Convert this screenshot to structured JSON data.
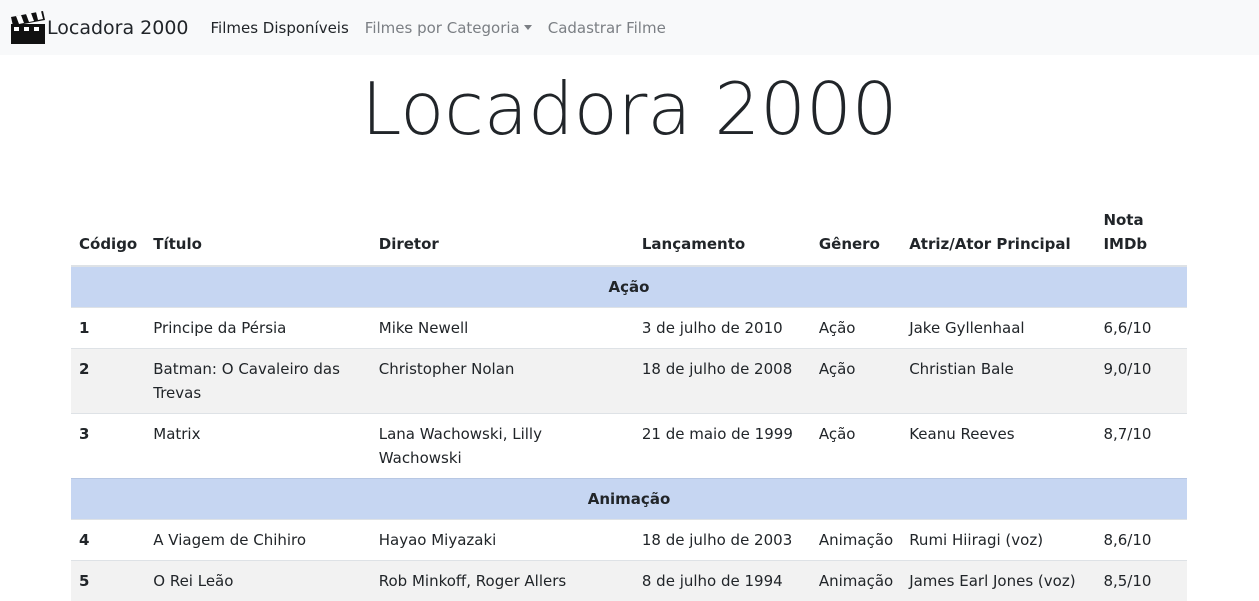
{
  "navbar": {
    "brand": "Locadora 2000",
    "links": [
      {
        "label": "Filmes Disponíveis"
      },
      {
        "label": "Filmes por Categoria"
      },
      {
        "label": "Cadastrar Filme"
      }
    ]
  },
  "page_title": "Locadora 2000",
  "table": {
    "headers": [
      "Código",
      "Título",
      "Diretor",
      "Lançamento",
      "Gênero",
      "Atriz/Ator Principal",
      "Nota IMDb"
    ],
    "groups": [
      {
        "category": "Ação",
        "rows": [
          [
            "1",
            "Principe da Pérsia",
            "Mike Newell",
            "3 de julho de 2010",
            "Ação",
            "Jake Gyllenhaal",
            "6,6/10"
          ],
          [
            "2",
            "Batman: O Cavaleiro das Trevas",
            "Christopher Nolan",
            "18 de julho de 2008",
            "Ação",
            "Christian Bale",
            "9,0/10"
          ],
          [
            "3",
            "Matrix",
            "Lana Wachowski, Lilly Wachowski",
            "21 de maio de 1999",
            "Ação",
            "Keanu Reeves",
            "8,7/10"
          ]
        ]
      },
      {
        "category": "Animação",
        "rows": [
          [
            "4",
            "A Viagem de Chihiro",
            "Hayao Miyazaki",
            "18 de julho de 2003",
            "Animação",
            "Rumi Hiiragi (voz)",
            "8,6/10"
          ],
          [
            "5",
            "O Rei Leão",
            "Rob Minkoff, Roger Allers",
            "8 de julho de 1994",
            "Animação",
            "James Earl Jones (voz)",
            "8,5/10"
          ]
        ]
      }
    ]
  }
}
